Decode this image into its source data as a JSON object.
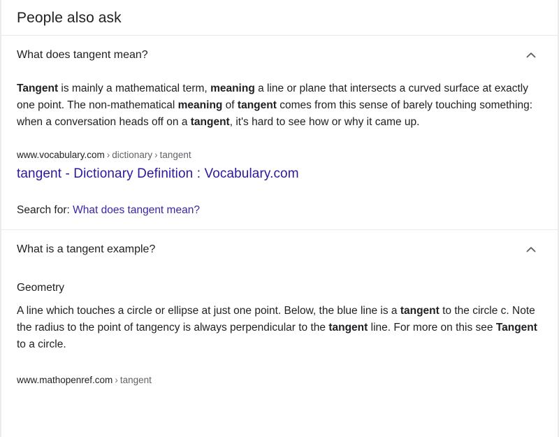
{
  "card": {
    "header_title": "People also ask",
    "chevron_icon": "chevron-up-icon"
  },
  "colors": {
    "text": "#202124",
    "link": "#2b199c",
    "link_search_for": "#3b24a8",
    "url_secondary": "#5f6368",
    "divider": "#ebebeb",
    "card_border": "#ebebeb"
  },
  "questions": [
    {
      "question": "What does tangent mean?",
      "expanded": true,
      "answer_runs": [
        {
          "text": "Tangent",
          "bold": true
        },
        {
          "text": " is mainly a mathematical term, ",
          "bold": false
        },
        {
          "text": "meaning",
          "bold": true
        },
        {
          "text": " a line or plane that intersects a curved surface at exactly one point. The non-mathematical ",
          "bold": false
        },
        {
          "text": "meaning",
          "bold": true
        },
        {
          "text": " of ",
          "bold": false
        },
        {
          "text": "tangent",
          "bold": true
        },
        {
          "text": " comes from this sense of barely touching something: when a conversation heads off on a ",
          "bold": false
        },
        {
          "text": "tangent",
          "bold": true
        },
        {
          "text": ", it's hard to see how or why it came up.",
          "bold": false
        }
      ],
      "source": {
        "domain": "www.vocabulary.com",
        "crumbs": [
          "dictionary",
          "tangent"
        ],
        "separator": "›",
        "title": "tangent - Dictionary Definition : Vocabulary.com"
      },
      "search_for": {
        "label": "Search for:",
        "query": "What does tangent mean?"
      }
    },
    {
      "question": "What is a tangent example?",
      "expanded": true,
      "subhead": "Geometry",
      "answer_runs": [
        {
          "text": "A line which touches a circle or ellipse at just one point. Below, the blue line is a ",
          "bold": false
        },
        {
          "text": "tangent",
          "bold": true
        },
        {
          "text": " to the circle c. Note the radius to the point of tangency is always perpendicular to the ",
          "bold": false
        },
        {
          "text": "tangent",
          "bold": true
        },
        {
          "text": " line. For more on this see ",
          "bold": false
        },
        {
          "text": "Tangent",
          "bold": true
        },
        {
          "text": " to a circle.",
          "bold": false
        }
      ],
      "source": {
        "domain": "www.mathopenref.com",
        "crumbs": [
          "tangent"
        ],
        "separator": "›",
        "title": ""
      }
    }
  ]
}
